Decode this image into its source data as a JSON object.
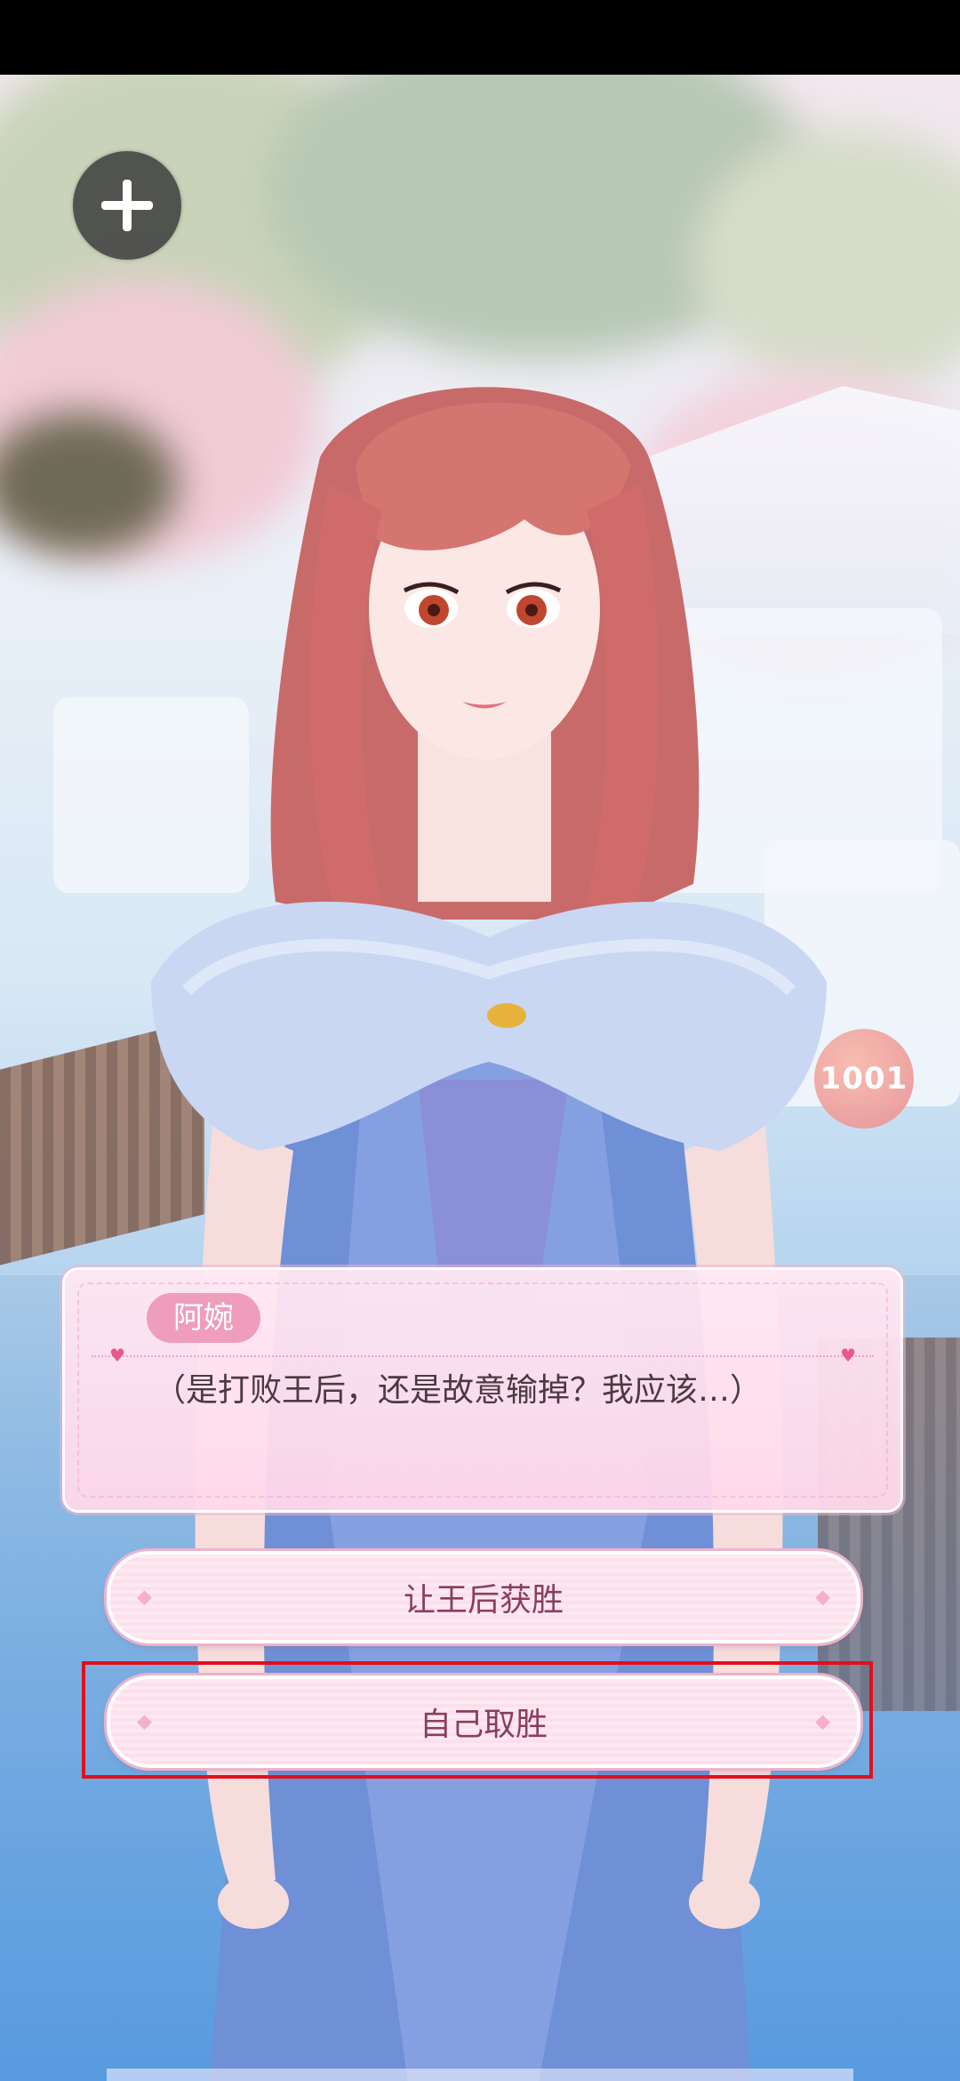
{
  "dialog": {
    "speaker": "阿婉",
    "text": "（是打败王后，还是故意输掉？我应该…）"
  },
  "choices": [
    {
      "label": "让王后获胜"
    },
    {
      "label": "自己取胜"
    }
  ],
  "badge": {
    "text": "1001"
  },
  "icons": {
    "menu": "plus-icon",
    "dialog_marker": "heart-icon"
  },
  "colors": {
    "highlight": "#e0101c",
    "name_tag": "#ee9dbb",
    "choice_text": "#8a3e5a"
  }
}
